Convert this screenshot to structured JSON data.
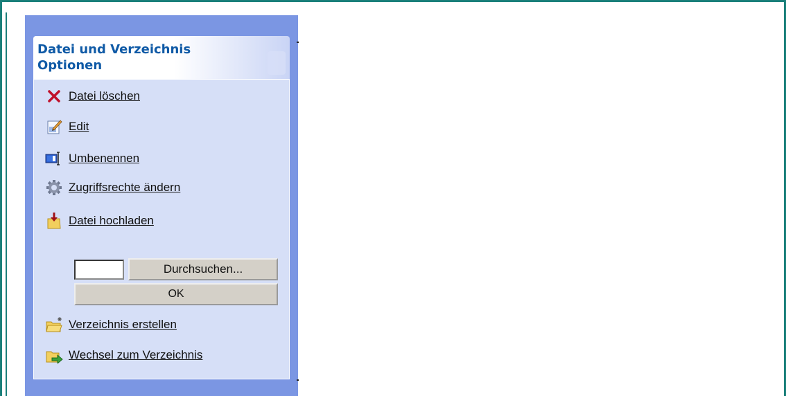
{
  "panel": {
    "title": "Datei und Verzeichnis Optionen"
  },
  "tasks": [
    {
      "label": "Datei löschen",
      "icon": "delete-x-icon"
    },
    {
      "label": "Edit",
      "icon": "edit-document-icon"
    },
    {
      "label": "Umbenennen",
      "icon": "rename-icon"
    },
    {
      "label": "Zugriffsrechte ändern",
      "icon": "gear-icon"
    },
    {
      "label": "Datei hochladen",
      "icon": "upload-folder-icon"
    },
    {
      "label": "Verzeichnis erstellen",
      "icon": "new-folder-icon"
    },
    {
      "label": "Wechsel zum Verzeichnis",
      "icon": "go-to-folder-icon"
    }
  ],
  "upload": {
    "file_value": "",
    "browse_label": "Durchsuchen...",
    "ok_label": "OK"
  },
  "colors": {
    "frame": "#1a7f7a",
    "taskpane": "#7b96e3",
    "group_body": "#d6dff7",
    "title": "#0f5aa6"
  }
}
